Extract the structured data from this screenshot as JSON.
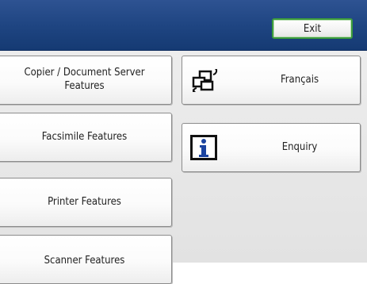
{
  "header": {
    "exit_label": "Exit"
  },
  "left_buttons": [
    {
      "label": "Copier / Document Server\nFeatures"
    },
    {
      "label": "Facsimile Features"
    },
    {
      "label": "Printer Features"
    },
    {
      "label": "Scanner Features"
    }
  ],
  "right_buttons": [
    {
      "label": "Français",
      "icon": "language-switch-icon"
    },
    {
      "label": "Enquiry",
      "icon": "info-icon"
    }
  ],
  "colors": {
    "title_bar": "#1f4582",
    "exit_border": "#3c9c3c",
    "info_icon_blue": "#1c44a0"
  }
}
